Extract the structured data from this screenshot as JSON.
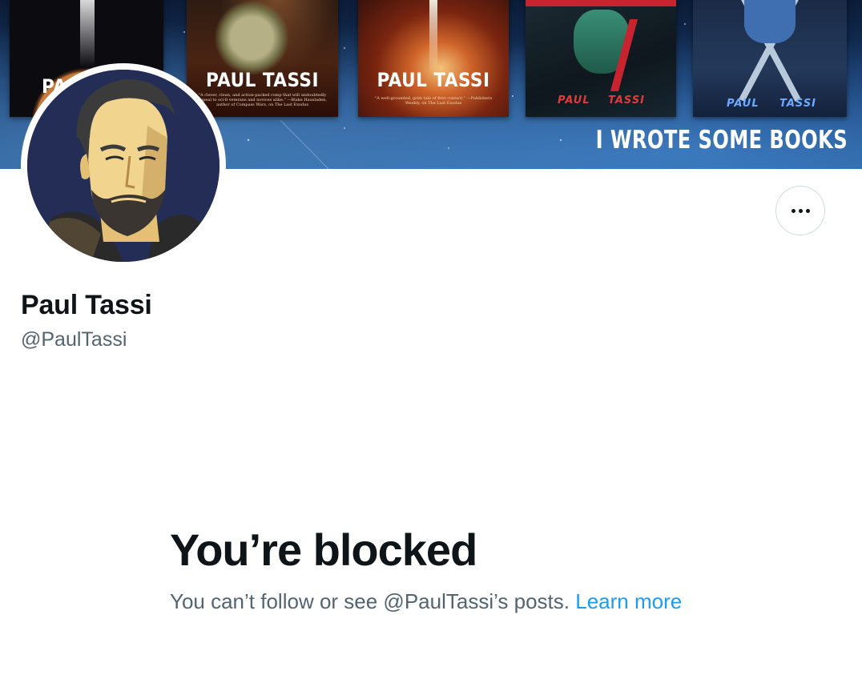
{
  "banner": {
    "books": [
      {
        "author": "PA"
      },
      {
        "author": "PAUL TASSI",
        "blurb": "\"A clever, clean, and action-packed romp that will undoubtedly appeal to sci-fi veterans and novices alike.\" —Blake Hausladen, author of Compass Wars, on The Last Exodus"
      },
      {
        "author": "PAUL TASSI",
        "blurb": "\"A well-grounded, grim tale of first contact.\" —Publishers Weekly, on The Last Exodus"
      },
      {
        "author_first": "PAUL",
        "author_last": "TASSI"
      },
      {
        "author_first": "PAUL",
        "author_last": "TASSI"
      }
    ],
    "tagline": "I WROTE SOME BOOKS"
  },
  "profile": {
    "display_name": "Paul Tassi",
    "handle": "@PaulTassi"
  },
  "more_button": {
    "icon": "more-horizontal-icon"
  },
  "blocked": {
    "title": "You’re blocked",
    "message": "You can’t follow or see @PaulTassi’s posts.",
    "link_text": "Learn more"
  },
  "colors": {
    "text_primary": "#0f1419",
    "text_secondary": "#536471",
    "link": "#1d9bf0",
    "button_border": "#cfd9de"
  }
}
